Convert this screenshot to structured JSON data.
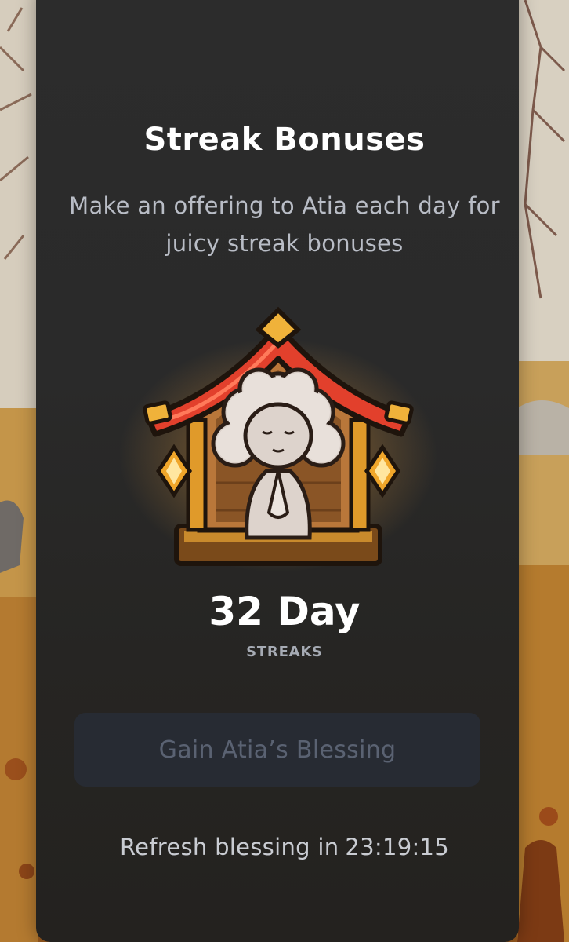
{
  "modal": {
    "title": "Streak Bonuses",
    "subtitle": "Make an offering to Atia each day for juicy streak bonuses",
    "streak_count": "32 Day",
    "streak_label": "STREAKS",
    "button_label": "Gain Atia’s Blessing",
    "refresh_prefix": "Refresh blessing in",
    "refresh_time": "23:19:15"
  },
  "icons": {
    "shrine": "shrine-icon",
    "sparkle": "sparkle-icon"
  },
  "colors": {
    "panel_background": "#2a2a2a",
    "button_background": "#272b33",
    "button_text_disabled": "#5a6272",
    "roof_red": "#e2402c",
    "gold": "#f0a62a"
  }
}
